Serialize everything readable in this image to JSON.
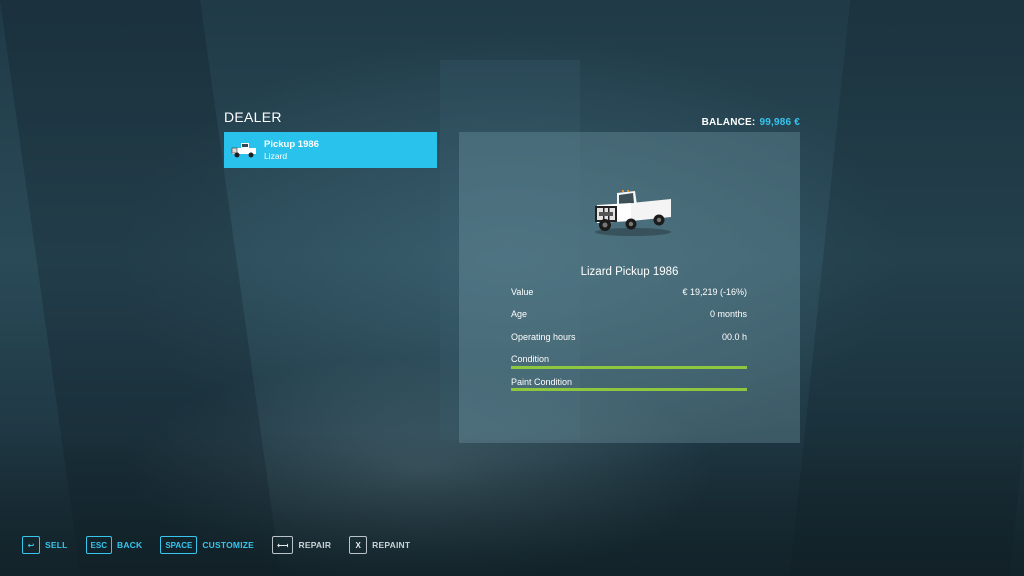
{
  "screen": {
    "title": "DEALER",
    "balance_label": "BALANCE:",
    "balance_value": "99,986 €"
  },
  "list": {
    "items": [
      {
        "name": "Pickup 1986",
        "brand": "Lizard",
        "icon": "pickup-truck-icon",
        "selected": true
      }
    ]
  },
  "details": {
    "vehicle_title": "Lizard Pickup 1986",
    "value_label": "Value",
    "value": "€ 19,219 (-16%)",
    "age_label": "Age",
    "age": "0 months",
    "hours_label": "Operating hours",
    "hours": "00.0 h",
    "condition_label": "Condition",
    "condition_level": 1.0,
    "paint_label": "Paint Condition",
    "paint_level": 1.0
  },
  "footer": {
    "actions": [
      {
        "key": "↩",
        "label": "SELL",
        "enabled": true
      },
      {
        "key": "ESC",
        "label": "BACK",
        "enabled": true
      },
      {
        "key": "SPACE",
        "label": "CUSTOMIZE",
        "enabled": true
      },
      {
        "key": "⟻",
        "label": "REPAIR",
        "enabled": false
      },
      {
        "key": "X",
        "label": "REPAINT",
        "enabled": false
      }
    ]
  },
  "colors": {
    "accent": "#36c6ef",
    "selected_item": "#28c2ec",
    "bar_fill": "#8dc63f"
  }
}
